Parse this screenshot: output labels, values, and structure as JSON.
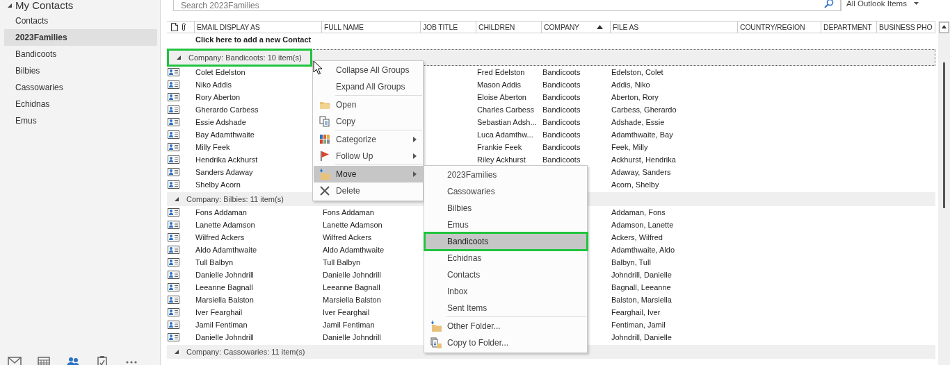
{
  "sidebar": {
    "header": "My Contacts",
    "expanded": true,
    "items": [
      {
        "label": "Contacts",
        "selected": false
      },
      {
        "label": "2023Families",
        "selected": true
      },
      {
        "label": "Bandicoots",
        "selected": false
      },
      {
        "label": "Bilbies",
        "selected": false
      },
      {
        "label": "Cassowaries",
        "selected": false
      },
      {
        "label": "Echidnas",
        "selected": false
      },
      {
        "label": "Emus",
        "selected": false
      }
    ]
  },
  "nav": [
    {
      "kind": "mail",
      "selected": false
    },
    {
      "kind": "calendar",
      "selected": false
    },
    {
      "kind": "people",
      "selected": true
    },
    {
      "kind": "tasks",
      "selected": false
    },
    {
      "kind": "more",
      "selected": false
    }
  ],
  "search": {
    "placeholder": "Search 2023Families",
    "scope": "All Outlook Items"
  },
  "table": {
    "columns": [
      {
        "label": "EMAIL DISPLAY AS"
      },
      {
        "label": "FULL NAME"
      },
      {
        "label": "JOB TITLE"
      },
      {
        "label": "CHILDREN"
      },
      {
        "label": "COMPANY",
        "sorted": true
      },
      {
        "label": "FILE AS"
      },
      {
        "label": "COUNTRY/REGION"
      },
      {
        "label": "DEPARTMENT"
      },
      {
        "label": "BUSINESS PHO"
      }
    ],
    "add_row": "Click here to add a new Contact",
    "groups": [
      {
        "label": "Company: Bandicoots: 10 item(s)",
        "expanded": true,
        "focused": true,
        "highlighted": true,
        "rows": [
          {
            "email_display_as": "Colet Edelston",
            "children": "Fred Edelston",
            "company": "Bandicoots",
            "file_as": "Edelston, Colet"
          },
          {
            "email_display_as": "Niko Addis",
            "children": "Mason Addis",
            "company": "Bandicoots",
            "file_as": "Addis, Niko"
          },
          {
            "email_display_as": "Rory Aberton",
            "children": "Eloise Aberton",
            "company": "Bandicoots",
            "file_as": "Aberton, Rory"
          },
          {
            "email_display_as": "Gherardo Carbess",
            "children": "Charles Carbess",
            "company": "Bandicoots",
            "file_as": "Carbess, Gherardo"
          },
          {
            "email_display_as": "Essie Adshade",
            "children": "Sebastian Adsh...",
            "company": "Bandicoots",
            "file_as": "Adshade, Essie"
          },
          {
            "email_display_as": "Bay Adamthwaite",
            "children": "Luca Adamthw...",
            "company": "Bandicoots",
            "file_as": "Adamthwaite, Bay"
          },
          {
            "email_display_as": "Milly Feek",
            "children": "Frankie Feek",
            "company": "Bandicoots",
            "file_as": "Feek, Milly"
          },
          {
            "email_display_as": "Hendrika Ackhurst",
            "children": "Riley Ackhurst",
            "company": "Bandicoots",
            "file_as": "Ackhurst, Hendrika"
          },
          {
            "email_display_as": "Sanders Adaway",
            "file_as": "Adaway, Sanders"
          },
          {
            "email_display_as": "Shelby Acorn",
            "file_as": "Acorn, Shelby"
          }
        ]
      },
      {
        "label": "Company: Bilbies: 11 item(s)",
        "expanded": true,
        "focused": false,
        "highlighted": false,
        "rows": [
          {
            "email_display_as": "Fons Addaman",
            "full_name": "Fons Addaman",
            "file_as": "Addaman, Fons"
          },
          {
            "email_display_as": "Lanette Adamson",
            "full_name": "Lanette Adamson",
            "file_as": "Adamson, Lanette"
          },
          {
            "email_display_as": "Wilfred Ackers",
            "full_name": "Wilfred Ackers",
            "file_as": "Ackers, Wilfred"
          },
          {
            "email_display_as": "Aldo Adamthwaite",
            "full_name": "Aldo Adamthwaite",
            "file_as": "Adamthwaite, Aldo"
          },
          {
            "email_display_as": "Tull Balbyn",
            "full_name": "Tull Balbyn",
            "file_as": "Balbyn, Tull"
          },
          {
            "email_display_as": "Danielle Johndrill",
            "full_name": "Danielle Johndrill",
            "file_as": "Johndrill, Danielle"
          },
          {
            "email_display_as": "Leeanne Bagnall",
            "full_name": "Leeanne Bagnall",
            "file_as": "Bagnall, Leeanne"
          },
          {
            "email_display_as": "Marsiella Balston",
            "full_name": "Marsiella Balston",
            "file_as": "Balston, Marsiella"
          },
          {
            "email_display_as": "Iver Fearghail",
            "full_name": "Iver Fearghail",
            "file_as": "Fearghail, Iver"
          },
          {
            "email_display_as": "Jamil Fentiman",
            "full_name": "Jamil Fentiman",
            "file_as": "Fentiman, Jamil"
          },
          {
            "email_display_as": "Danielle Johndrill",
            "full_name": "Danielle Johndrill",
            "file_as": "Johndrill, Danielle"
          }
        ]
      },
      {
        "label": "Company: Cassowaries: 11 item(s)",
        "expanded": true,
        "focused": false,
        "highlighted": false
      }
    ]
  },
  "context_menu": {
    "items": [
      {
        "label": "Collapse All Groups",
        "selected": false
      },
      {
        "label": "Expand All Groups",
        "selected": false
      },
      {
        "label": "Open",
        "kind": "open",
        "separator_before": true,
        "selected": false
      },
      {
        "label": "Copy",
        "kind": "copy",
        "selected": false
      },
      {
        "label": "Categorize",
        "kind": "categorize",
        "separator_before": true,
        "submenu": true,
        "selected": false
      },
      {
        "label": "Follow Up",
        "kind": "flag",
        "submenu": true,
        "selected": false
      },
      {
        "label": "Move",
        "kind": "move",
        "separator_before": true,
        "submenu": true,
        "selected": true
      },
      {
        "label": "Delete",
        "kind": "delete",
        "selected": false
      }
    ]
  },
  "move_submenu": {
    "items": [
      {
        "label": "2023Families",
        "selected": false
      },
      {
        "label": "Cassowaries",
        "selected": false
      },
      {
        "label": "Bilbies",
        "selected": false
      },
      {
        "label": "Emus",
        "selected": false
      },
      {
        "label": "Bandicoots",
        "selected": true,
        "highlighted": true
      },
      {
        "label": "Echidnas",
        "selected": false
      },
      {
        "label": "Contacts",
        "selected": false
      },
      {
        "label": "Inbox",
        "selected": false
      },
      {
        "label": "Sent Items",
        "selected": false
      },
      {
        "label": "Other Folder...",
        "kind": "move",
        "separator_before": true,
        "selected": false
      },
      {
        "label": "Copy to Folder...",
        "kind": "copyfolder",
        "selected": false
      }
    ]
  }
}
